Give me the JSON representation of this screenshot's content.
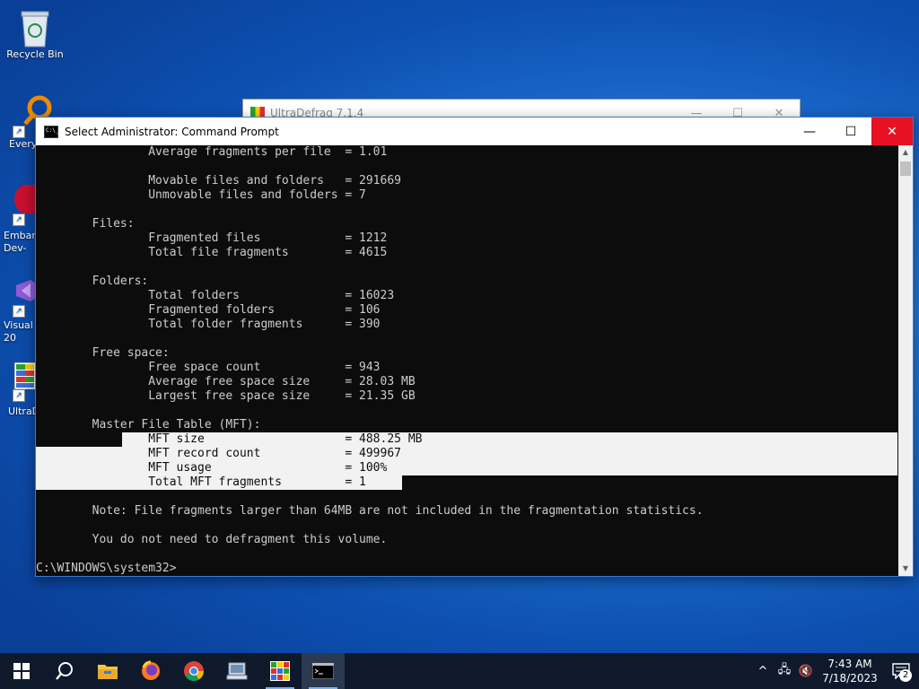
{
  "desktop": {
    "icons": [
      {
        "label": "Recycle Bin",
        "icon": "recycle-bin-icon"
      },
      {
        "label": "Every",
        "icon": "everything-icon"
      },
      {
        "label": "Embar Dev-",
        "icon": "embarcadero-devcpp-icon"
      },
      {
        "label": "Visual 20",
        "icon": "visual-studio-icon"
      },
      {
        "label": "UltraD",
        "icon": "ultradefrag-icon"
      }
    ]
  },
  "ultradefrag_window": {
    "title": "UltraDefrag 7.1.4",
    "minimize": "—",
    "maximize": "☐",
    "close": "✕"
  },
  "cmd_window": {
    "title": "Select Administrator:  Command Prompt",
    "minimize": "—",
    "maximize": "☐",
    "close": "✕",
    "lines": [
      "                Average fragments per file  = 1.01",
      "",
      "                Movable files and folders   = 291669",
      "                Unmovable files and folders = 7",
      "",
      "        Files:",
      "                Fragmented files            = 1212",
      "                Total file fragments        = 4615",
      "",
      "        Folders:",
      "                Total folders               = 16023",
      "                Fragmented folders          = 106",
      "                Total folder fragments      = 390",
      "",
      "        Free space:",
      "                Free space count            = 943",
      "                Average free space size     = 28.03 MB",
      "                Largest free space size     = 21.35 GB",
      "",
      "        Master File Table (MFT):",
      "                MFT size                    = 488.25 MB",
      "                MFT record count            = 499967",
      "                MFT usage                   = 100%",
      "                Total MFT fragments         = 1",
      "",
      "        Note: File fragments larger than 64MB are not included in the fragmentation statistics.",
      "",
      "        You do not need to defragment this volume.",
      "",
      "C:\\WINDOWS\\system32>"
    ]
  },
  "taskbar": {
    "items": [
      {
        "name": "start-button",
        "icon": "windows-logo-icon"
      },
      {
        "name": "search-button",
        "icon": "search-icon"
      },
      {
        "name": "file-explorer",
        "icon": "folder-icon"
      },
      {
        "name": "firefox",
        "icon": "firefox-icon"
      },
      {
        "name": "chrome",
        "icon": "chrome-icon"
      },
      {
        "name": "app-generic",
        "icon": "computer-icon"
      },
      {
        "name": "ultradefrag",
        "icon": "ultradefrag-icon"
      },
      {
        "name": "command-prompt",
        "icon": "cmd-icon"
      }
    ],
    "tray": {
      "chevron": "^",
      "network": "🖧",
      "volume": "🔇",
      "time": "7:43 AM",
      "date": "7/18/2023",
      "notifications": "2"
    }
  },
  "colors": {
    "console_bg": "#0c0c0c",
    "console_text": "#cccccc",
    "selection_bg": "#f2f2f2",
    "close_red": "#e81123",
    "taskbar": "#0e1a2c"
  }
}
